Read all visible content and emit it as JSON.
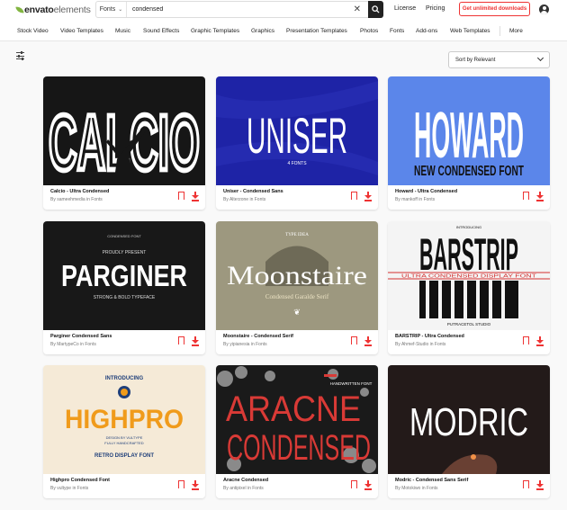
{
  "header": {
    "logo_part1": "envato",
    "logo_part2": "elements",
    "category": "Fonts",
    "search_value": "condensed",
    "license": "License",
    "pricing": "Pricing",
    "cta": "Get unlimited downloads"
  },
  "nav": [
    "Stock Video",
    "Video Templates",
    "Music",
    "Sound Effects",
    "Graphic Templates",
    "Graphics",
    "Presentation Templates",
    "Photos",
    "Fonts",
    "Add-ons",
    "Web Templates",
    "More"
  ],
  "sort": {
    "label": "Sort by Relevant"
  },
  "cards": [
    {
      "title": "Calcio - Ultra Condensed",
      "author": "By sameehmedia in Fonts",
      "bg": "#161616",
      "fg": "#ffffff",
      "lines": [
        "CALCIO"
      ]
    },
    {
      "title": "Uniser - Condensed Sans",
      "author": "By Alterzone in Fonts",
      "bg": "#1e23a6",
      "fg": "#ffffff",
      "lines": [
        "UNISER",
        "4 FONTS"
      ]
    },
    {
      "title": "Howard - Ultra Condensed",
      "author": "By mankoff in Fonts",
      "bg": "#5b86ea",
      "fg": "#ffffff",
      "lines": [
        "HOWARD",
        "NEW CONDENSED FONT"
      ]
    },
    {
      "title": "Parginer Condensed Sans",
      "author": "By MartypeCo in Fonts",
      "bg": "#181818",
      "fg": "#ffffff",
      "lines": [
        "PROUDLY PRESENT",
        "PARGINER",
        "STRONG & BOLD TYPEFACE",
        "CONDENSED FONT"
      ]
    },
    {
      "title": "Moonstaire - Condensed Serif",
      "author": "By yipianesia in Fonts",
      "bg": "#9d987f",
      "fg": "#ffffff",
      "lines": [
        "TYPE IDEA",
        "Moonstaire",
        "Condensed Garalde Serif"
      ]
    },
    {
      "title": "BARSTRIP - Ultra Condensed",
      "author": "By Ahmef-Studio in Fonts",
      "bg": "#f4f4f4",
      "fg": "#111111",
      "lines": [
        "INTRODUCING",
        "BARSTRIP",
        "ULTRA CONDENSED DISPLAY FONT",
        "PUTRACETOL STUDIO"
      ]
    },
    {
      "title": "Highpro Condensed Font",
      "author": "By vultype in Fonts",
      "bg": "#f5ead7",
      "fg": "#f09b1b",
      "lines": [
        "INTRODUCING",
        "HIGHPRO",
        "DESIGN BY VULTYPE",
        "FULLY HANDCRAFTED",
        "RETRO DISPLAY FONT"
      ]
    },
    {
      "title": "Aracne Condensed",
      "author": "By antipixel in Fonts",
      "bg": "#1a1a1a",
      "fg": "#d93a36",
      "lines": [
        "ARACNE",
        "CONDENSED",
        "HANDWRITTEN FONT"
      ]
    },
    {
      "title": "Modric - Condensed Sans Serif",
      "author": "By Motokiwo in Fonts",
      "bg": "#231a19",
      "fg": "#ffffff",
      "lines": [
        "MODRIC"
      ]
    }
  ],
  "colors": {
    "accent": "#e33333",
    "logo_green": "#82b541"
  }
}
